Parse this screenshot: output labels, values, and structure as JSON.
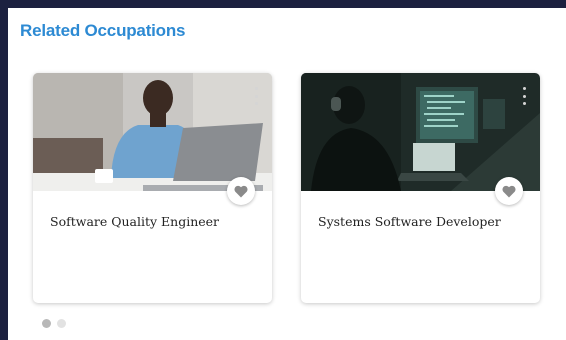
{
  "section": {
    "title": "Related Occupations"
  },
  "cards": [
    {
      "title": "Software Quality Engineer",
      "favorite_icon": "heart-icon",
      "menu_icon": "kebab-icon"
    },
    {
      "title": "Systems Software Developer",
      "favorite_icon": "heart-icon",
      "menu_icon": "kebab-icon"
    }
  ],
  "pagination": {
    "active_index": 0,
    "count": 2
  },
  "colors": {
    "title": "#2d8ad3",
    "frame": "#1c2140",
    "heart": "#8a8a8a"
  }
}
